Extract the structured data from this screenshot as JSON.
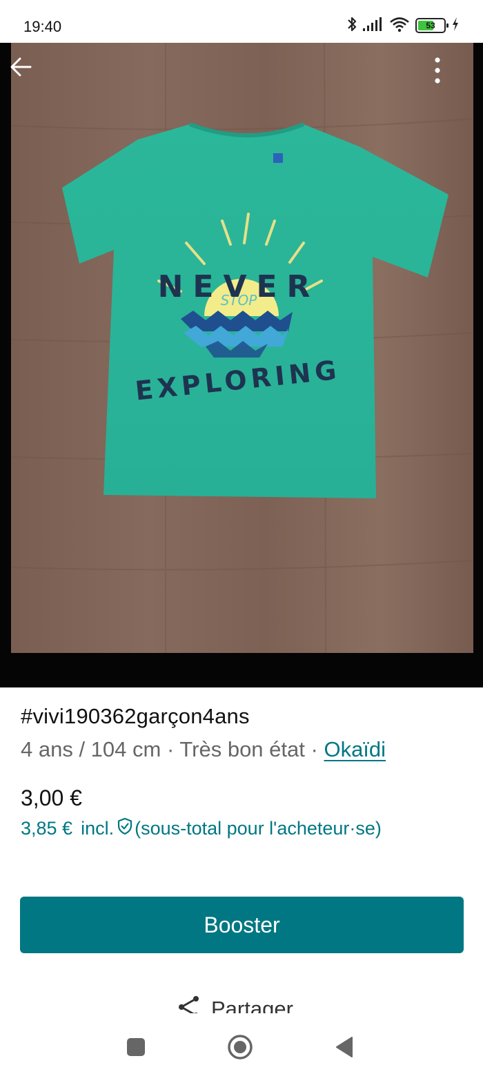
{
  "status_bar": {
    "time": "19:40",
    "battery_level": "53",
    "icons": [
      "bluetooth-icon",
      "signal-icon",
      "wifi-icon",
      "battery-icon",
      "charging-icon"
    ]
  },
  "hero": {
    "image_text": {
      "line1": "NEVER",
      "line2": "STOP",
      "line3": "EXPLORING"
    },
    "back_icon": "arrow-left-icon",
    "menu_icon": "more-vertical-icon"
  },
  "item": {
    "title": "#vivi190362garçon4ans",
    "size": "4 ans / 104 cm",
    "separator": "·",
    "condition": "Très bon état",
    "brand": "Okaïdi",
    "price": "3,00 €",
    "price_with_fee": "3,85 €",
    "incl_label": "incl.",
    "buyer_note": "(sous-total pour l'acheteur·se)"
  },
  "actions": {
    "booster_label": "Booster",
    "share_label": "Partager"
  },
  "colors": {
    "accent": "#007782",
    "text": "#111111",
    "muted": "#666666"
  }
}
